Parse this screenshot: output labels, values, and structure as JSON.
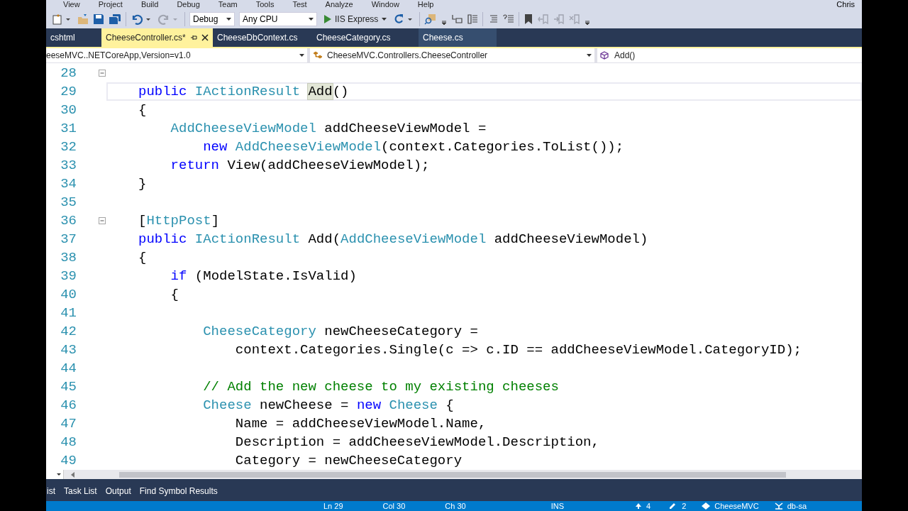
{
  "menu": [
    "View",
    "Project",
    "Build",
    "Debug",
    "Team",
    "Tools",
    "Test",
    "Analyze",
    "Window",
    "Help"
  ],
  "user": "Chris",
  "toolbar": {
    "configuration": "Debug",
    "platform": "Any CPU",
    "run_target": "IIS Express"
  },
  "tabs": [
    {
      "label": "cshtml",
      "selected": false
    },
    {
      "label": "CheeseController.cs*",
      "selected": true
    },
    {
      "label": "CheeseDbContext.cs",
      "selected": false
    },
    {
      "label": "CheeseCategory.cs",
      "selected": false
    },
    {
      "label": "Cheese.cs",
      "selected": false
    }
  ],
  "navigation": {
    "project": "eeseMVC..NETCoreApp,Version=v1.0",
    "type": "CheeseMVC.Controllers.CheeseController",
    "member": "Add()"
  },
  "code_lines": [
    {
      "number": "28",
      "current": false,
      "expanded": true
    },
    {
      "number": "29",
      "current": true,
      "tokens": [
        {
          "kind": "keyword",
          "text": "public"
        },
        {
          "kind": "type",
          "text": " IActionResult "
        },
        {
          "kind": "match",
          "text": "Add"
        },
        {
          "kind": "plain",
          "text": "()"
        }
      ]
    },
    {
      "number": "30",
      "current": false,
      "tokens": [
        {
          "kind": "plain",
          "text": "{"
        }
      ]
    },
    {
      "number": "31",
      "current": false,
      "tokens": [
        {
          "kind": "type",
          "text": "    AddCheeseViewModel"
        },
        {
          "kind": "plain",
          "text": " addCheeseViewModel ="
        }
      ]
    },
    {
      "number": "32",
      "current": false,
      "tokens": [
        {
          "kind": "keyword",
          "text": "        new"
        },
        {
          "kind": "type",
          "text": " AddCheeseViewModel"
        },
        {
          "kind": "plain",
          "text": "(context.Categories.ToList());"
        }
      ]
    },
    {
      "number": "33",
      "current": false,
      "tokens": [
        {
          "kind": "keyword",
          "text": "    return"
        },
        {
          "kind": "plain",
          "text": " View(addCheeseViewModel);"
        }
      ]
    },
    {
      "number": "34",
      "current": false,
      "tokens": [
        {
          "kind": "plain",
          "text": "}"
        }
      ]
    },
    {
      "number": "35",
      "current": false
    },
    {
      "number": "36",
      "current": false,
      "expanded": true,
      "tokens": [
        {
          "kind": "plain",
          "text": "["
        },
        {
          "kind": "type",
          "text": "HttpPost"
        },
        {
          "kind": "plain",
          "text": "]"
        }
      ]
    },
    {
      "number": "37",
      "current": false,
      "tokens": [
        {
          "kind": "keyword",
          "text": "public"
        },
        {
          "kind": "type",
          "text": " IActionResult"
        },
        {
          "kind": "plain",
          "text": " Add("
        },
        {
          "kind": "type",
          "text": "AddCheeseViewModel"
        },
        {
          "kind": "plain",
          "text": " addCheeseViewModel)"
        }
      ]
    },
    {
      "number": "38",
      "current": false,
      "tokens": [
        {
          "kind": "plain",
          "text": "{"
        }
      ]
    },
    {
      "number": "39",
      "current": false,
      "tokens": [
        {
          "kind": "keyword",
          "text": "    if"
        },
        {
          "kind": "plain",
          "text": " (ModelState.IsValid)"
        }
      ]
    },
    {
      "number": "40",
      "current": false,
      "tokens": [
        {
          "kind": "plain",
          "text": "    {"
        }
      ]
    },
    {
      "number": "41",
      "current": false
    },
    {
      "number": "42",
      "current": false,
      "tokens": [
        {
          "kind": "type",
          "text": "        CheeseCategory"
        },
        {
          "kind": "plain",
          "text": " newCheeseCategory ="
        }
      ]
    },
    {
      "number": "43",
      "current": false,
      "tokens": [
        {
          "kind": "plain",
          "text": "            context.Categories.Single(c => c.ID == addCheeseViewModel.CategoryID);"
        }
      ]
    },
    {
      "number": "44",
      "current": false
    },
    {
      "number": "45",
      "current": false,
      "tokens": [
        {
          "kind": "comment",
          "text": "        // Add the new cheese to my existing cheeses"
        }
      ]
    },
    {
      "number": "46",
      "current": false,
      "tokens": [
        {
          "kind": "type",
          "text": "        Cheese"
        },
        {
          "kind": "plain",
          "text": " newCheese = "
        },
        {
          "kind": "keyword",
          "text": "new"
        },
        {
          "kind": "type",
          "text": " Cheese"
        },
        {
          "kind": "plain",
          "text": " {"
        }
      ]
    },
    {
      "number": "47",
      "current": false,
      "tokens": [
        {
          "kind": "plain",
          "text": "            Name = addCheeseViewModel.Name,"
        }
      ]
    },
    {
      "number": "48",
      "current": false,
      "tokens": [
        {
          "kind": "plain",
          "text": "            Description = addCheeseViewModel.Description,"
        }
      ]
    },
    {
      "number": "49",
      "current": false,
      "tokens": [
        {
          "kind": "plain",
          "text": "            Category = newCheeseCategory"
        }
      ]
    }
  ],
  "tool_tabs": [
    "ist",
    "Task List",
    "Output",
    "Find Symbol Results"
  ],
  "status_bar": {
    "line": "Ln 29",
    "column": "Col 30",
    "char": "Ch 30",
    "mode": "INS",
    "publish_count": "4",
    "changes": "2",
    "repository": "CheeseMVC",
    "branch": "db-sa"
  }
}
